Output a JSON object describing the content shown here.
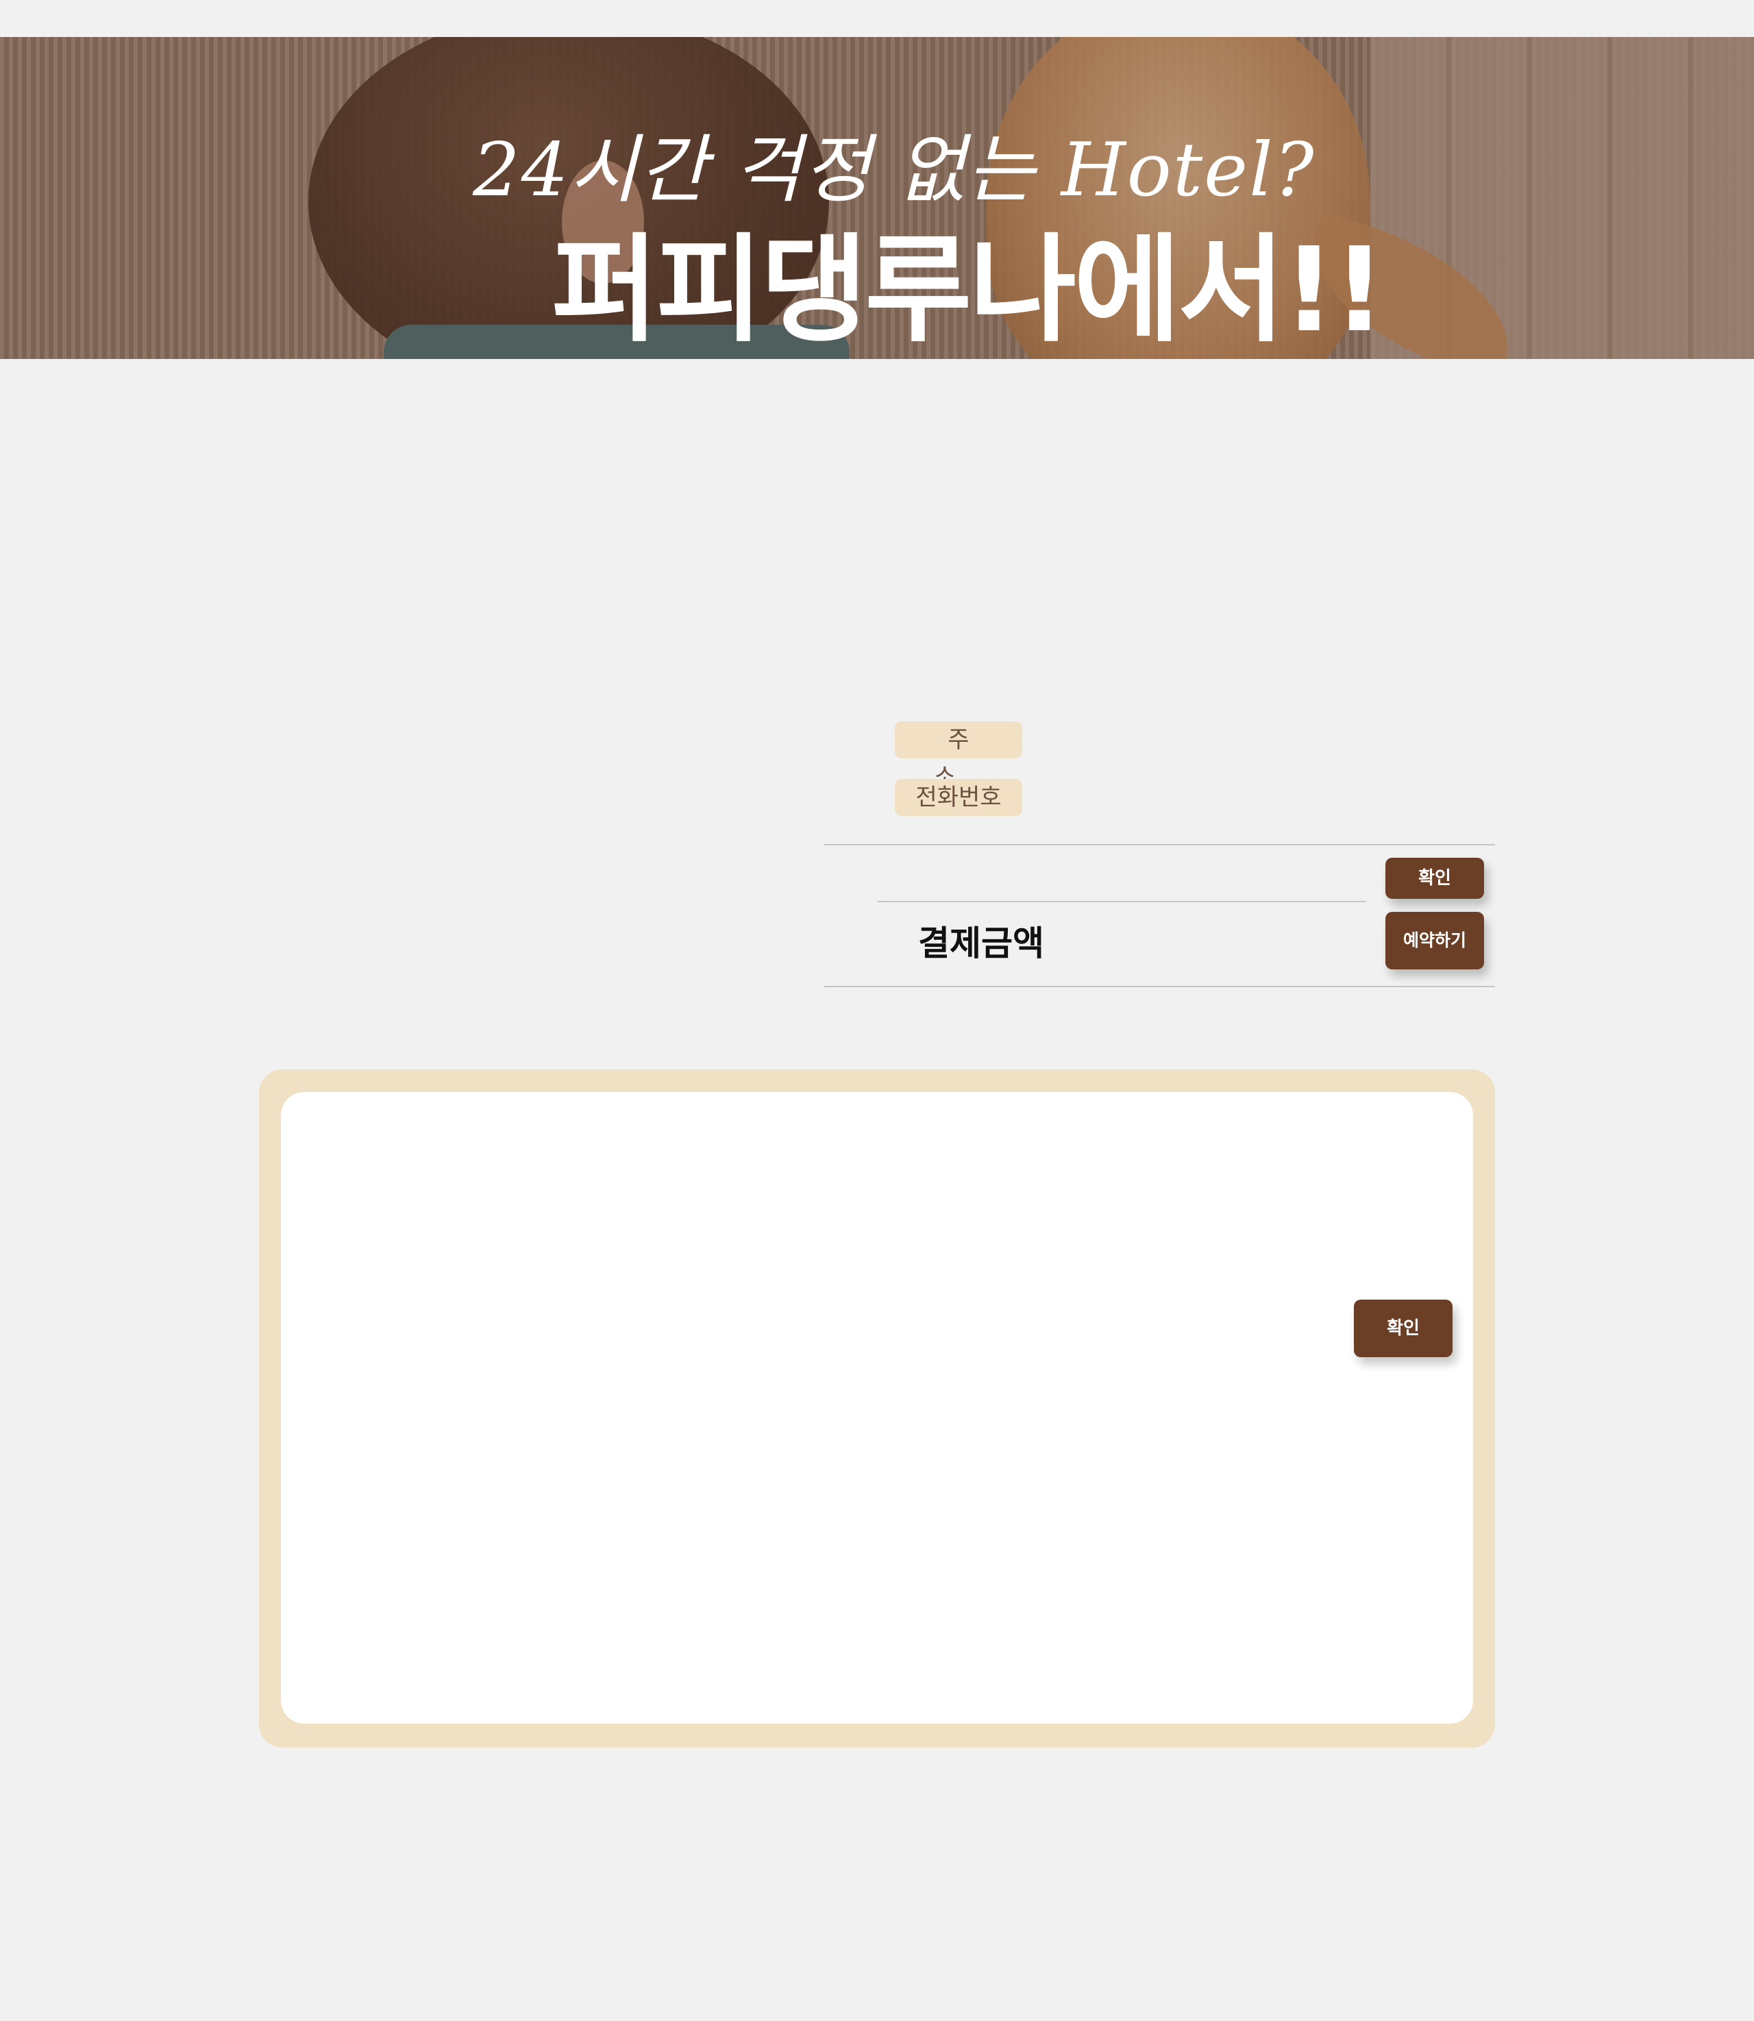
{
  "hero": {
    "subtitle": "24시간 걱정 없는 Hotel?",
    "title": "퍼피댕루나에서!!"
  },
  "info": {
    "address_label": "주 소",
    "phone_label": "전화번호"
  },
  "actions": {
    "confirm_label": "확인",
    "reserve_label": "예약하기"
  },
  "payment": {
    "label": "결제금액"
  },
  "modal": {
    "confirm_label": "확인"
  },
  "colors": {
    "page_background": "#f1f1f1",
    "tag_background": "#f2e0c5",
    "button_brown": "#6b3f25",
    "modal_frame": "#f0e0c4"
  }
}
